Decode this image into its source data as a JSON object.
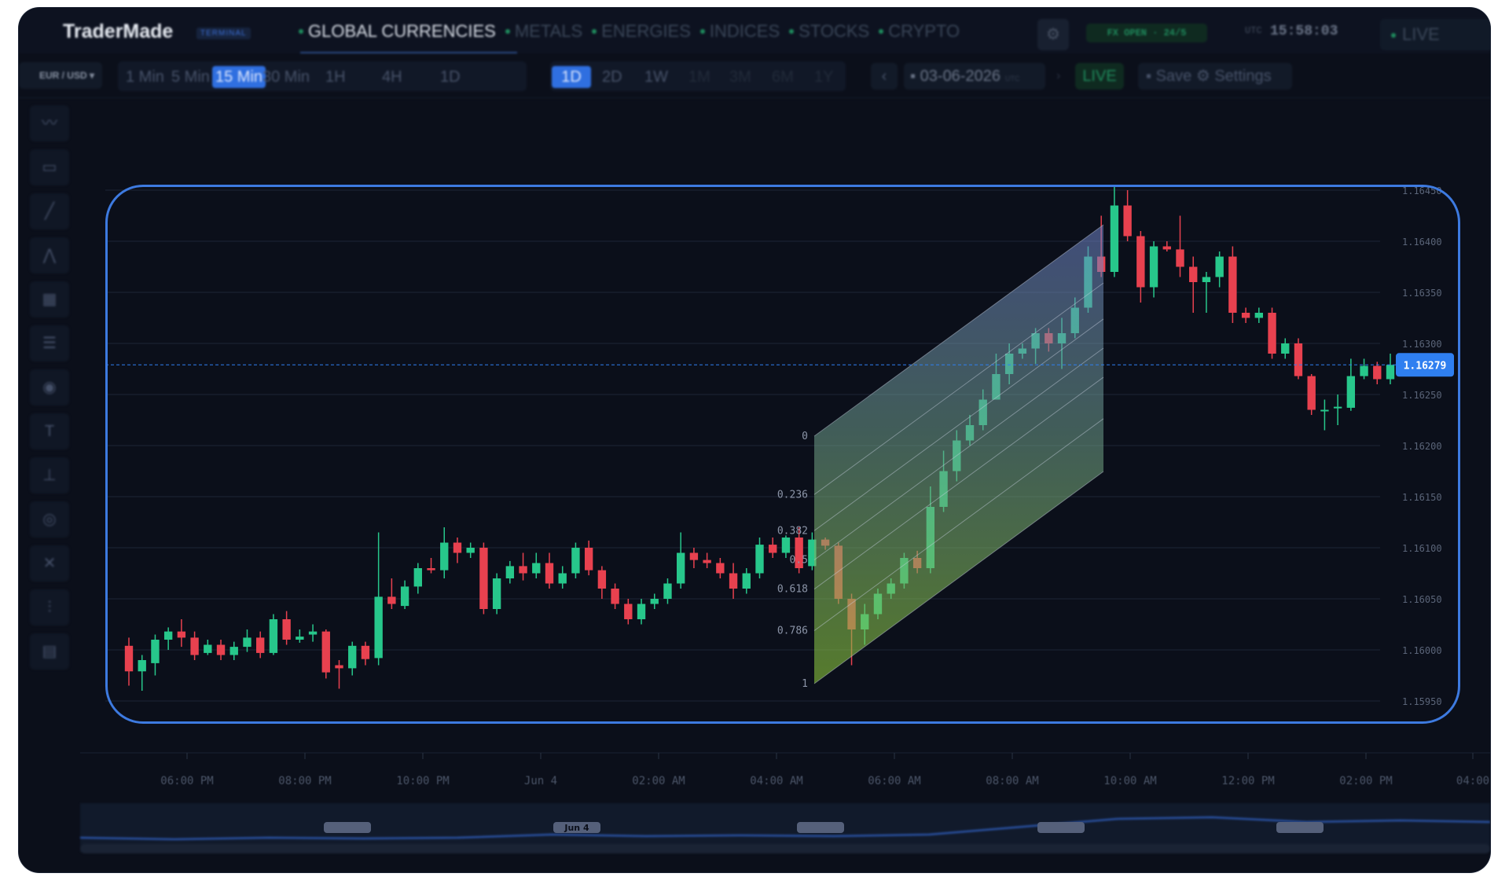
{
  "app": {
    "brand": "TraderMade",
    "brand_badge": "TERMINAL"
  },
  "nav": {
    "items": [
      {
        "label": "GLOBAL CURRENCIES",
        "active": true
      },
      {
        "label": "METALS"
      },
      {
        "label": "ENERGIES"
      },
      {
        "label": "INDICES"
      },
      {
        "label": "STOCKS"
      },
      {
        "label": "CRYPTO"
      }
    ],
    "market_status": "FX OPEN · 24/5",
    "utc_label": "UTC",
    "clock": "15:58:03",
    "live_rates": "LIVE RATES"
  },
  "toolbar": {
    "pair": "EUR / USD",
    "timeframes": [
      "1 Min",
      "5 Min",
      "15 Min",
      "30 Min",
      "1H",
      "4H",
      "1D"
    ],
    "active_timeframe": "15 Min",
    "ranges": [
      "1D",
      "2D",
      "1W",
      "1M",
      "3M",
      "6M",
      "1Y"
    ],
    "active_range": "1D",
    "date": "03-06-2026",
    "date_utc": "UTC",
    "live_label": "LIVE",
    "save_label": "Save",
    "settings_label": "Settings"
  },
  "tools": [
    "trend-tool-icon",
    "note-tool-icon",
    "line-tool-icon",
    "pattern-tool-icon",
    "grid-tool-icon",
    "fib-tool-icon",
    "eye-tool-icon",
    "text-tool-icon",
    "measure-tool-icon",
    "hide-tool-icon",
    "expand-tool-icon",
    "indicator-tool-icon",
    "trash-tool-icon"
  ],
  "colors": {
    "up": "#27c78b",
    "down": "#e8414f",
    "accent": "#2f6fe0",
    "highlight": "#3d7ae0",
    "price_tag": "#2f7ff0"
  },
  "chart_data": {
    "type": "candlestick",
    "current_price": "1.16279",
    "price_axis": [
      "1.16450",
      "1.16400",
      "1.16350",
      "1.16300",
      "1.16250",
      "1.16200",
      "1.16150",
      "1.16100",
      "1.16050",
      "1.16000",
      "1.15950"
    ],
    "time_axis": [
      "06:00 PM",
      "08:00 PM",
      "10:00 PM",
      "Jun 4",
      "02:00 AM",
      "04:00 AM",
      "06:00 AM",
      "08:00 AM",
      "10:00 AM",
      "12:00 PM",
      "02:00 PM",
      "04:00"
    ],
    "fib_levels": [
      "0",
      "0.236",
      "0.382",
      "0.5",
      "0.618",
      "0.786",
      "1"
    ],
    "navigator_labels": [
      "",
      "Jun 4",
      "",
      "",
      ""
    ],
    "candles": [
      [
        1.16004,
        1.15979,
        1.16012,
        1.15965
      ],
      [
        1.15979,
        1.1599,
        1.15995,
        1.1596
      ],
      [
        1.15987,
        1.1601,
        1.16015,
        1.15975
      ],
      [
        1.1601,
        1.16018,
        1.16022,
        1.16
      ],
      [
        1.16018,
        1.16012,
        1.1603,
        1.16003
      ],
      [
        1.16012,
        1.15995,
        1.16018,
        1.1599
      ],
      [
        1.15997,
        1.16005,
        1.1601,
        1.15995
      ],
      [
        1.16005,
        1.15995,
        1.1601,
        1.1599
      ],
      [
        1.15995,
        1.16003,
        1.16008,
        1.1599
      ],
      [
        1.16003,
        1.16012,
        1.1602,
        1.15998
      ],
      [
        1.16012,
        1.15997,
        1.16018,
        1.15992
      ],
      [
        1.15997,
        1.1603,
        1.16035,
        1.15995
      ],
      [
        1.1603,
        1.1601,
        1.16038,
        1.16005
      ],
      [
        1.1601,
        1.16013,
        1.1602,
        1.16007
      ],
      [
        1.16015,
        1.16018,
        1.16025,
        1.16008
      ],
      [
        1.16018,
        1.15978,
        1.1602,
        1.15972
      ],
      [
        1.15985,
        1.15982,
        1.1599,
        1.15962
      ],
      [
        1.15982,
        1.16004,
        1.16008,
        1.15975
      ],
      [
        1.16004,
        1.15991,
        1.16008,
        1.15985
      ],
      [
        1.15992,
        1.16052,
        1.16115,
        1.15985
      ],
      [
        1.16052,
        1.16045,
        1.1607,
        1.1604
      ],
      [
        1.16043,
        1.16062,
        1.16068,
        1.1604
      ],
      [
        1.16062,
        1.1608,
        1.16085,
        1.16055
      ],
      [
        1.1608,
        1.16078,
        1.1609,
        1.16075
      ],
      [
        1.16078,
        1.16105,
        1.1612,
        1.1607
      ],
      [
        1.16105,
        1.16095,
        1.1611,
        1.16085
      ],
      [
        1.16095,
        1.161,
        1.16105,
        1.1609
      ],
      [
        1.161,
        1.1604,
        1.16105,
        1.16035
      ],
      [
        1.1604,
        1.1607,
        1.16075,
        1.16035
      ],
      [
        1.1607,
        1.16082,
        1.16087,
        1.16065
      ],
      [
        1.16082,
        1.16075,
        1.16095,
        1.16068
      ],
      [
        1.16075,
        1.16085,
        1.16095,
        1.1607
      ],
      [
        1.16085,
        1.16065,
        1.16095,
        1.1606
      ],
      [
        1.16065,
        1.16075,
        1.16082,
        1.1606
      ],
      [
        1.16075,
        1.161,
        1.16105,
        1.1607
      ],
      [
        1.161,
        1.16078,
        1.16107,
        1.16073
      ],
      [
        1.16078,
        1.1606,
        1.16082,
        1.1605
      ],
      [
        1.1606,
        1.16045,
        1.16065,
        1.1604
      ],
      [
        1.16045,
        1.1603,
        1.1605,
        1.16025
      ],
      [
        1.1603,
        1.16045,
        1.1605,
        1.16025
      ],
      [
        1.16045,
        1.1605,
        1.16055,
        1.1604
      ],
      [
        1.1605,
        1.16065,
        1.1607,
        1.16045
      ],
      [
        1.16065,
        1.16095,
        1.16115,
        1.1606
      ],
      [
        1.16095,
        1.16088,
        1.161,
        1.1608
      ],
      [
        1.16088,
        1.16085,
        1.16095,
        1.1608
      ],
      [
        1.16085,
        1.16075,
        1.1609,
        1.1607
      ],
      [
        1.16075,
        1.1606,
        1.16085,
        1.1605
      ],
      [
        1.1606,
        1.16075,
        1.1608,
        1.16055
      ],
      [
        1.16075,
        1.16103,
        1.1611,
        1.1607
      ],
      [
        1.16103,
        1.16095,
        1.1611,
        1.1609
      ],
      [
        1.16095,
        1.1611,
        1.16112,
        1.1609
      ],
      [
        1.1611,
        1.1608,
        1.1612,
        1.16075
      ],
      [
        1.16082,
        1.16108,
        1.16115,
        1.16078
      ],
      [
        1.16108,
        1.16102,
        1.1611,
        1.16098
      ],
      [
        1.16102,
        1.1605,
        1.16105,
        1.16045
      ],
      [
        1.1605,
        1.1602,
        1.16055,
        1.15985
      ],
      [
        1.1602,
        1.16035,
        1.16045,
        1.16005
      ],
      [
        1.16035,
        1.16055,
        1.1606,
        1.1603
      ],
      [
        1.16055,
        1.16065,
        1.1607,
        1.1605
      ],
      [
        1.16065,
        1.1609,
        1.16095,
        1.1606
      ],
      [
        1.1609,
        1.1608,
        1.16097,
        1.16075
      ],
      [
        1.1608,
        1.1614,
        1.1616,
        1.16075
      ],
      [
        1.1614,
        1.16175,
        1.16195,
        1.16135
      ],
      [
        1.16175,
        1.16205,
        1.16215,
        1.16165
      ],
      [
        1.16205,
        1.1622,
        1.1623,
        1.162
      ],
      [
        1.1622,
        1.16245,
        1.16255,
        1.16215
      ],
      [
        1.16245,
        1.1627,
        1.1629,
        1.16245
      ],
      [
        1.1627,
        1.1629,
        1.163,
        1.1626
      ],
      [
        1.1629,
        1.16295,
        1.163,
        1.16285
      ],
      [
        1.16295,
        1.1631,
        1.16315,
        1.1628
      ],
      [
        1.1631,
        1.163,
        1.16315,
        1.16292
      ],
      [
        1.163,
        1.1631,
        1.16325,
        1.16275
      ],
      [
        1.1631,
        1.16335,
        1.16345,
        1.16305
      ],
      [
        1.16335,
        1.16385,
        1.16395,
        1.1633
      ],
      [
        1.16385,
        1.1637,
        1.16425,
        1.16365
      ],
      [
        1.1637,
        1.16435,
        1.16455,
        1.16365
      ],
      [
        1.16435,
        1.16405,
        1.1645,
        1.164
      ],
      [
        1.16405,
        1.16355,
        1.1641,
        1.1634
      ],
      [
        1.16355,
        1.16395,
        1.164,
        1.16345
      ],
      [
        1.16395,
        1.16392,
        1.164,
        1.1639
      ],
      [
        1.16392,
        1.16375,
        1.16425,
        1.16365
      ],
      [
        1.16375,
        1.1636,
        1.16385,
        1.1633
      ],
      [
        1.1636,
        1.16365,
        1.1637,
        1.1633
      ],
      [
        1.16365,
        1.16385,
        1.1639,
        1.16355
      ],
      [
        1.16385,
        1.1633,
        1.16395,
        1.1632
      ],
      [
        1.1633,
        1.16325,
        1.16335,
        1.1632
      ],
      [
        1.16325,
        1.1633,
        1.16335,
        1.1632
      ],
      [
        1.1633,
        1.1629,
        1.16335,
        1.16285
      ],
      [
        1.1629,
        1.163,
        1.16305,
        1.16285
      ],
      [
        1.163,
        1.16268,
        1.16305,
        1.16265
      ],
      [
        1.16268,
        1.16235,
        1.1627,
        1.1623
      ],
      [
        1.16235,
        1.16235,
        1.16245,
        1.16215
      ],
      [
        1.16238,
        1.16238,
        1.1625,
        1.1622
      ],
      [
        1.16237,
        1.16268,
        1.16285,
        1.16234
      ],
      [
        1.16268,
        1.16278,
        1.16285,
        1.16265
      ],
      [
        1.16278,
        1.16265,
        1.16282,
        1.1626
      ],
      [
        1.16265,
        1.16279,
        1.1629,
        1.1626
      ]
    ]
  }
}
